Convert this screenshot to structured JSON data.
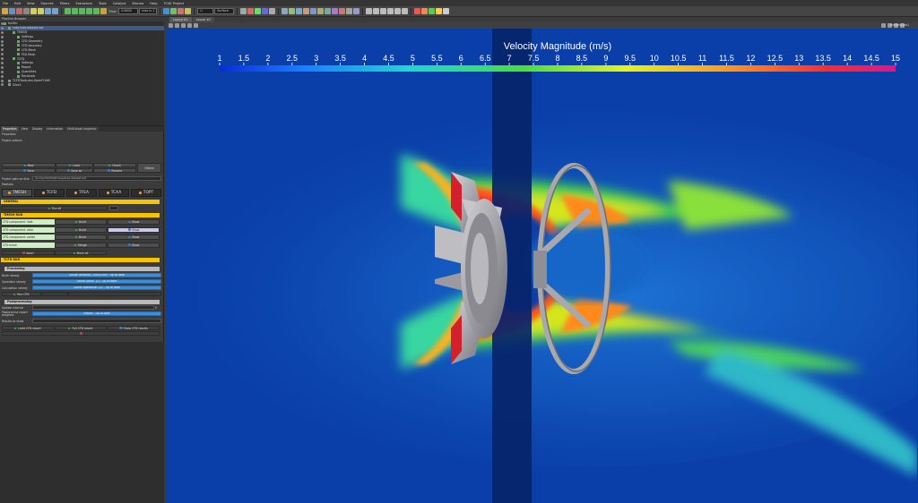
{
  "menubar": {
    "items": [
      "File",
      "Edit",
      "View",
      "Sources",
      "Filters",
      "Extractors",
      "Tools",
      "Catalyst",
      "Macros",
      "Help",
      "TCAE Project"
    ]
  },
  "toolbar": {
    "time_label": "Time:",
    "time_value": "0.0000",
    "index_value": "max is 1",
    "representation": "Surface",
    "variable": "U"
  },
  "pipeline": {
    "title": "Pipeline Browser",
    "items": [
      {
        "label": "builtin:",
        "depth": 0,
        "selected": false
      },
      {
        "label": "case.tcae.dataset.ext",
        "depth": 1,
        "selected": true
      },
      {
        "label": "TMESH",
        "depth": 2,
        "selected": false
      },
      {
        "label": "Settings",
        "depth": 3,
        "selected": false
      },
      {
        "label": "CFD Geometry",
        "depth": 3,
        "selected": false
      },
      {
        "label": "CFD boundary",
        "depth": 3,
        "selected": false
      },
      {
        "label": "CFD Mesh",
        "depth": 3,
        "selected": false
      },
      {
        "label": "FEA Mesh",
        "depth": 3,
        "selected": false
      },
      {
        "label": "TCFD",
        "depth": 2,
        "selected": false
      },
      {
        "label": "Settings",
        "depth": 3,
        "selected": false
      },
      {
        "label": "Report",
        "depth": 3,
        "selected": false
      },
      {
        "label": "Quantities",
        "depth": 3,
        "selected": false
      },
      {
        "label": "Residuals",
        "depth": 3,
        "selected": false
      },
      {
        "label": "TCFDTools.dev.OpenFOAM",
        "depth": 1,
        "selected": false
      },
      {
        "label": "Slice1",
        "depth": 1,
        "selected": false
      }
    ]
  },
  "panel_tabs": [
    "Properties",
    "View",
    "Display",
    "Information",
    "Multi-block Inspector"
  ],
  "properties": {
    "title": "Properties",
    "project_actions_label": "Project actions",
    "new_label": "New",
    "load_label": "Load",
    "check_label": "Check",
    "save_label": "Save",
    "save_as_label": "Save as",
    "restore_label": "Restore",
    "others_label": "Others",
    "project_path_label": "Project path on disk",
    "project_path_value": "/home/cfd/TCAE/case/tcae.dataset.ext",
    "modules_label": "Modules",
    "modules": [
      "TMESH",
      "TCFD",
      "TFEA",
      "TCAA",
      "TOPT"
    ],
    "general_label": "GENERAL",
    "run_all_label": "Run all",
    "tmesh_run_label": "TMESH RUN",
    "components": [
      {
        "name": "CFD component: inlet",
        "action": "Build",
        "show": "Show"
      },
      {
        "name": "CFD component: rotor",
        "action": "Build",
        "show": "Show"
      },
      {
        "name": "CFD component: outlet",
        "action": "Build",
        "show": "Show"
      },
      {
        "name": "CFD mesh",
        "action": "Merge",
        "show": "Show"
      }
    ],
    "abort_label": "Abort",
    "mesh_all_label": "Mesh all",
    "tcfd_run_label": "TCFD RUN",
    "processing_label": "Processing",
    "process_rows": [
      {
        "label": "Ninth steady",
        "value": "Solver iteration: 1000/1000 - up to date"
      },
      {
        "label": "Speedline steady",
        "value": "Solver point: 1/1 - up to date"
      },
      {
        "label": "Calculation steady",
        "value": "Solver speedline: 1/1 - up to date"
      }
    ],
    "run_cfd_label": "Run CFD",
    "postprocessing_label": "Postprocessing",
    "update_interval_label": "Update interval",
    "update_interval_value": "5",
    "update_report_label": "Postprocess report progress",
    "update_report_value": "Report - up to date",
    "results_to_show_label": "Results to show",
    "light_report_label": "Light CFD report",
    "full_report_label": "Full CFD report",
    "show_results_label": "Show CFD results"
  },
  "view_tabs": [
    "Layout #1",
    "Layout #2"
  ],
  "view_toolbar": {
    "render_view_label": "RenderView1"
  },
  "colorbar": {
    "title": "Velocity Magnitude (m/s)",
    "min": 1,
    "max": 15,
    "ticks": [
      "1",
      "1.5",
      "2",
      "2.5",
      "3",
      "3.5",
      "4",
      "4.5",
      "5",
      "5.5",
      "6",
      "6.5",
      "7",
      "7.5",
      "8",
      "8.5",
      "9",
      "9.5",
      "10",
      "10.5",
      "11",
      "11.5",
      "12",
      "12.5",
      "13",
      "13.5",
      "14",
      "14.5",
      "15"
    ]
  },
  "colors": {
    "background_flow": "#0a3ea8",
    "slice_band": "#06246a",
    "fan_surface": "#a9a9ad",
    "section_header": "#f6c400"
  }
}
